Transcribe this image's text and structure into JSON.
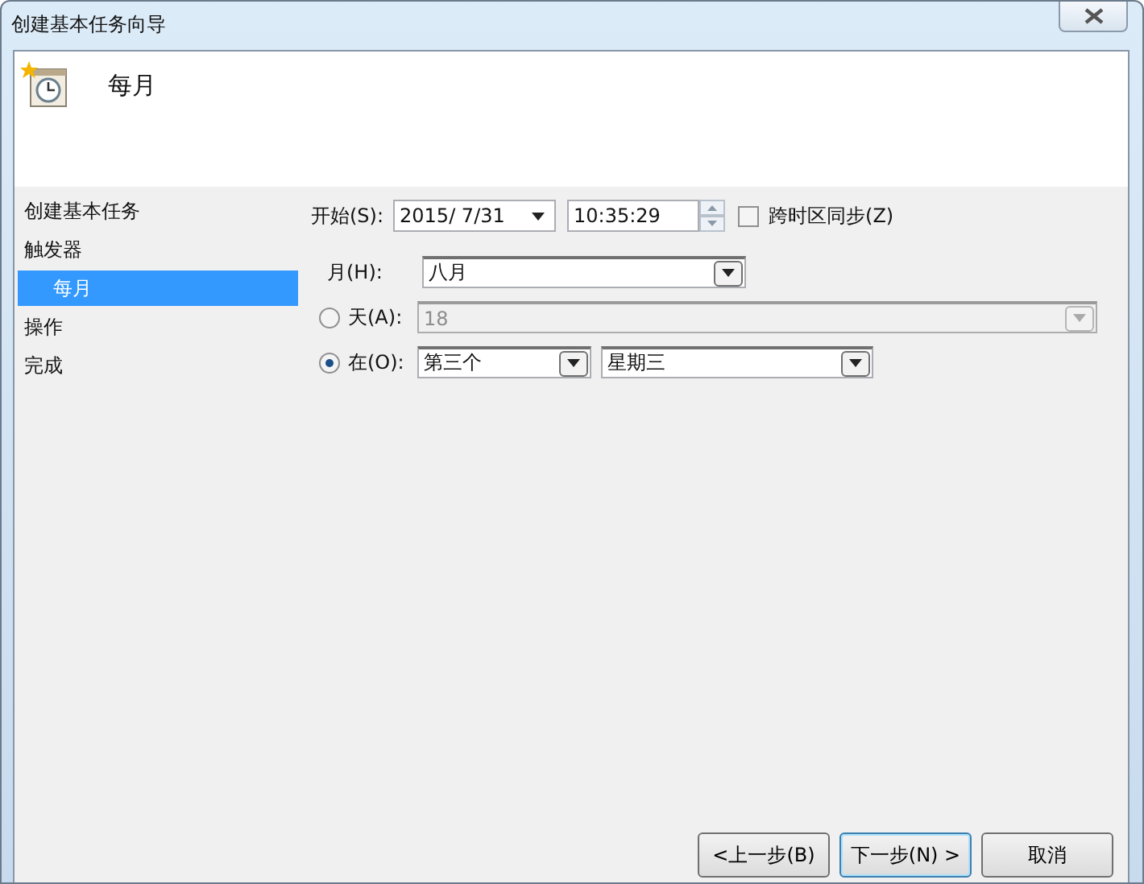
{
  "window": {
    "title": "创建基本任务向导"
  },
  "header": {
    "title": "每月"
  },
  "nav": {
    "items": [
      {
        "label": "创建基本任务",
        "selected": false
      },
      {
        "label": "触发器",
        "selected": false,
        "children": [
          {
            "label": "每月",
            "selected": true
          }
        ]
      },
      {
        "label": "操作",
        "selected": false
      },
      {
        "label": "完成",
        "selected": false
      }
    ]
  },
  "start": {
    "label": "开始(S):",
    "date": "2015/  7/31",
    "time": "10:35:29",
    "sync": {
      "label": "跨时区同步(Z)",
      "checked": false
    }
  },
  "month": {
    "label": "月(H):",
    "value": "八月"
  },
  "options": [
    {
      "kind": "day",
      "label": "天(A):",
      "selected": false,
      "value": "18"
    },
    {
      "kind": "on",
      "label": "在(O):",
      "selected": true,
      "week": "第三个",
      "weekday": "星期三"
    }
  ],
  "buttons": [
    {
      "label": "<上一步(B)",
      "default": false
    },
    {
      "label": "下一步(N) >",
      "default": true
    },
    {
      "label": "取消",
      "default": false
    }
  ]
}
